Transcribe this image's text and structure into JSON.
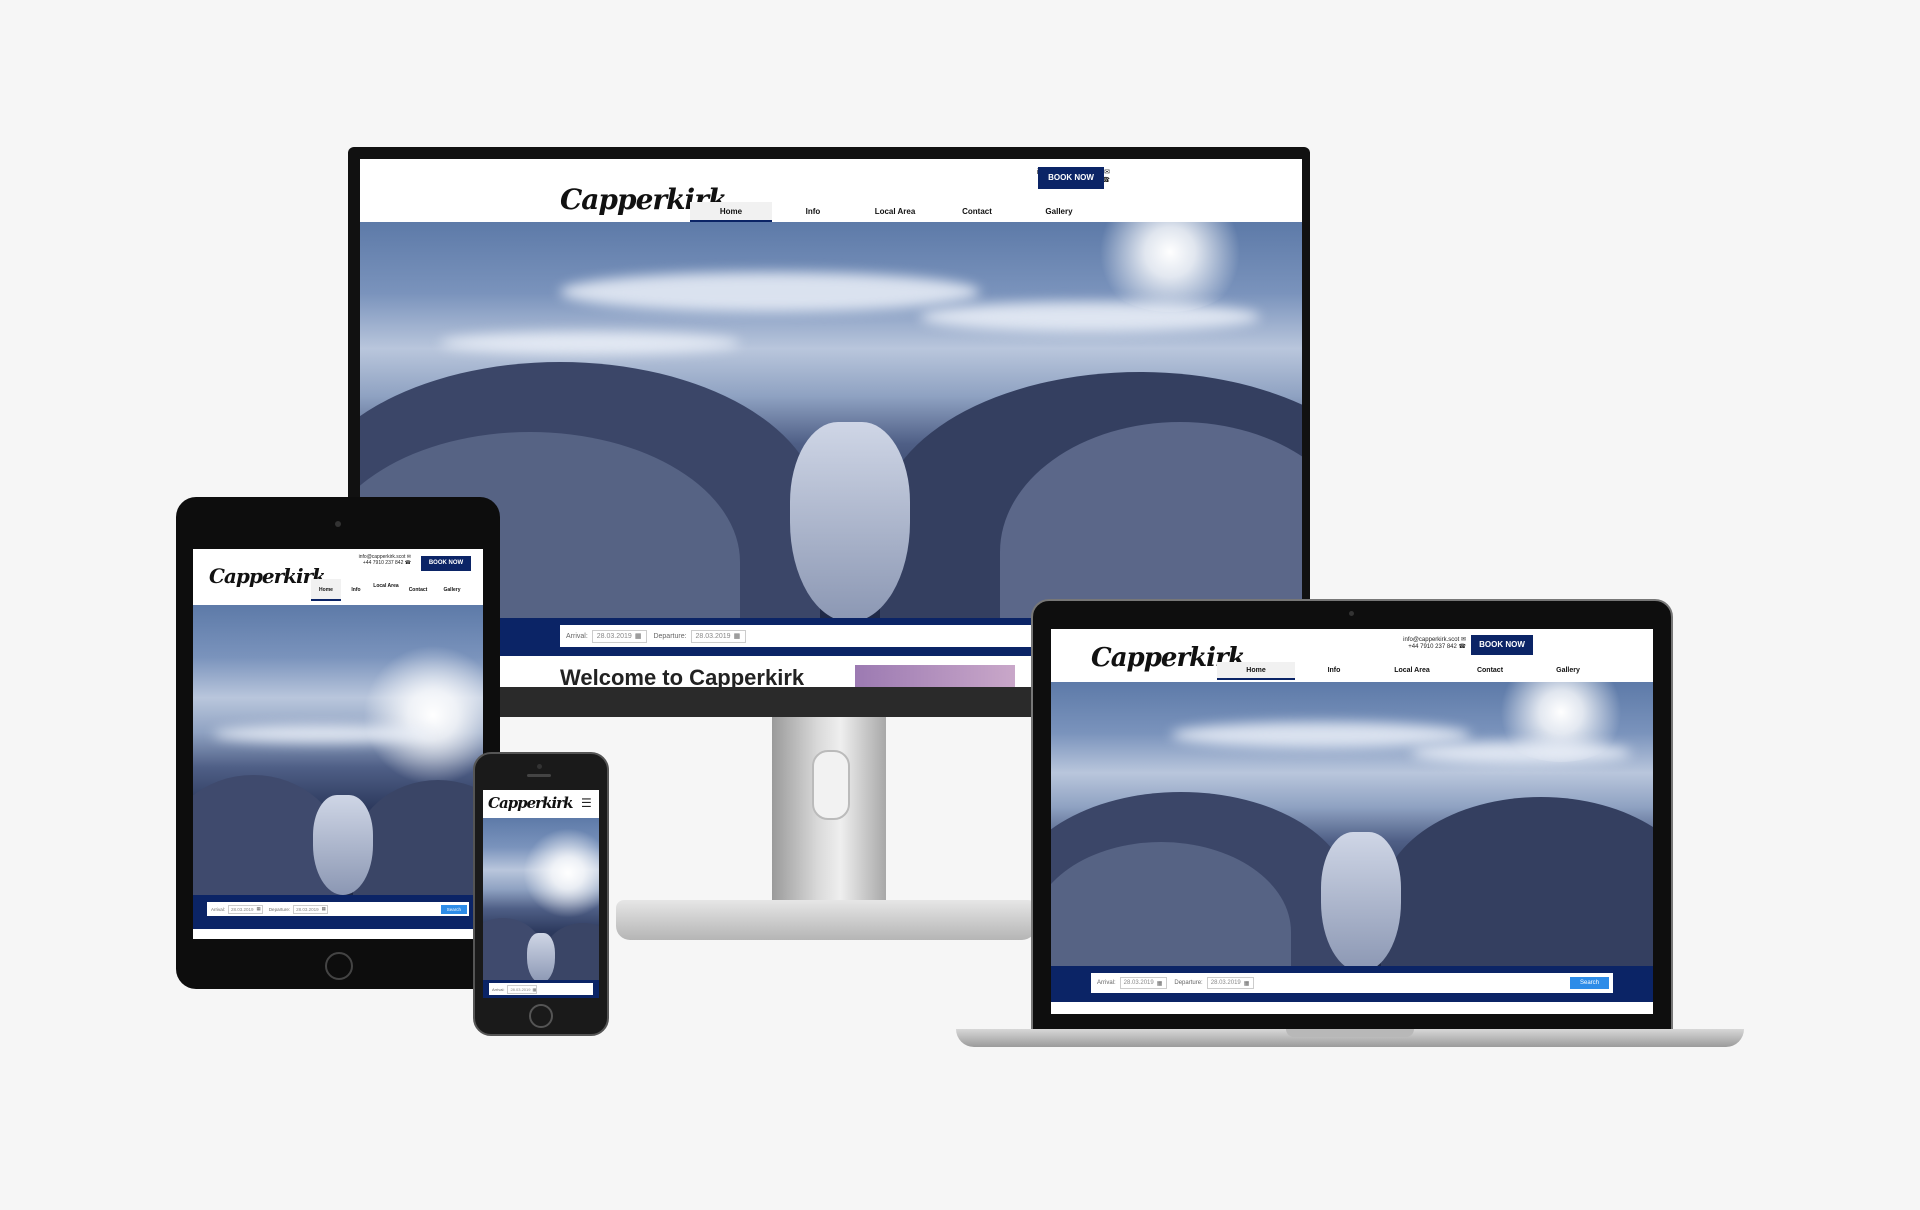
{
  "site": {
    "logo": "Capperkirk",
    "email": "info@capperkirk.scot",
    "phone": "+44 7910 237 842",
    "book_now": "BOOK NOW",
    "nav": [
      "Home",
      "Info",
      "Local Area",
      "Contact",
      "Gallery"
    ],
    "tablet_local_area": "Local Area",
    "arrival_label": "Arrival:",
    "arrival_value": "28.03.2019",
    "departure_label": "Departure:",
    "departure_value": "28.03.2019",
    "search_label": "Search",
    "welcome": "Welcome to Capperkirk"
  },
  "colors": {
    "brand_navy": "#0b2466",
    "search_blue": "#2d8ce8",
    "page_bg": "#f6f6f6"
  },
  "icons": {
    "mail": "envelope-icon",
    "phone": "phone-icon",
    "calendar": "calendar-icon",
    "menu": "hamburger-menu-icon"
  }
}
